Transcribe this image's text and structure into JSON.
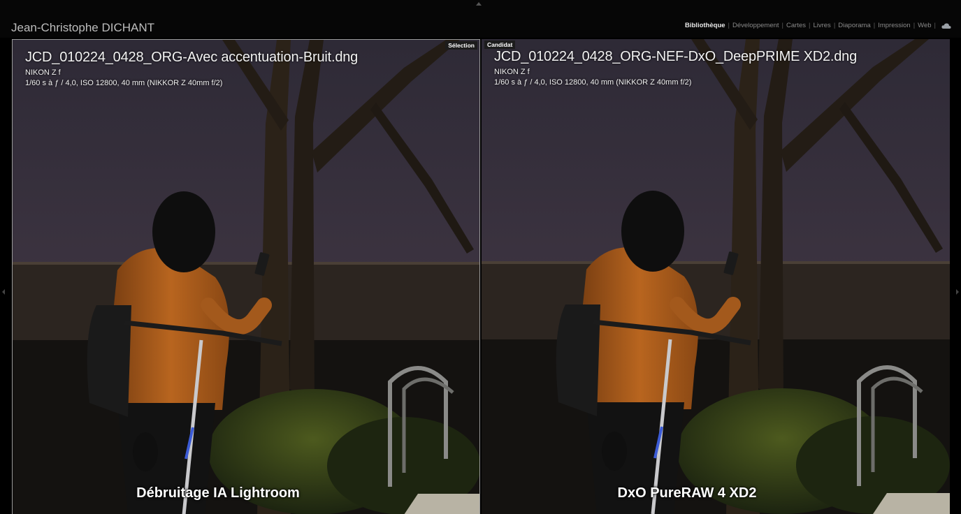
{
  "header": {
    "owner_name": "Jean-Christophe DICHANT",
    "modules": [
      "Bibliothèque",
      "Développement",
      "Cartes",
      "Livres",
      "Diaporama",
      "Impression",
      "Web"
    ],
    "active_module": "Bibliothèque",
    "cloud_icon": "cloud-sync-icon"
  },
  "compare": {
    "left": {
      "tag": "Sélection",
      "filename": "JCD_010224_0428_ORG-Avec accentuation-Bruit.dng",
      "camera": "NIKON Z f",
      "exif": "1/60 s à ƒ / 4,0, ISO 12800, 40 mm (NIKKOR Z 40mm f/2)",
      "caption": "Débruitage IA Lightroom"
    },
    "right": {
      "tag": "Candidat",
      "filename": "JCD_010224_0428_ORG-NEF-DxO_DeepPRIME XD2.dng",
      "camera": "NIKON Z f",
      "exif": "1/60 s à ƒ / 4,0, ISO 12800, 40 mm (NIKKOR Z 40mm f/2)",
      "caption": "DxO PureRAW 4 XD2"
    }
  },
  "colors": {
    "wall": "#3b3340",
    "ledge": "#2a2420",
    "jacket": "#b0601f",
    "foliage": "#2e3a16",
    "bark": "#2b2218"
  }
}
